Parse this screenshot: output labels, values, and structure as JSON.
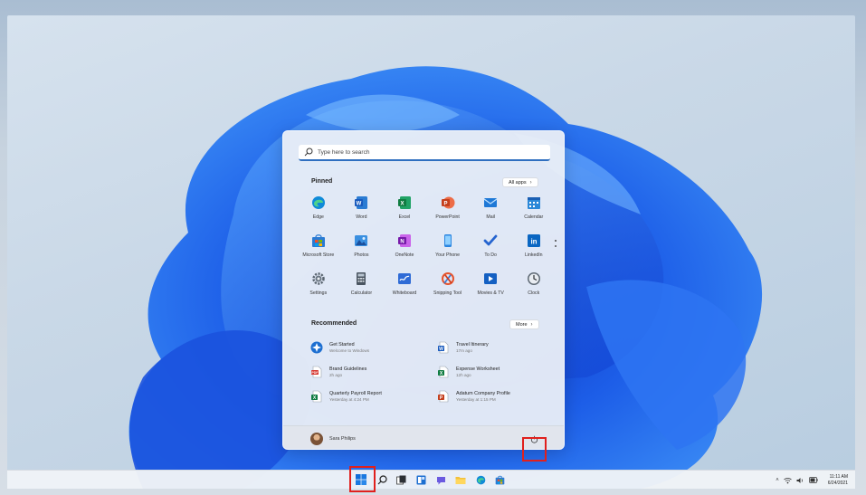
{
  "search": {
    "placeholder": "Type here to search"
  },
  "pinned": {
    "title": "Pinned",
    "all_apps_label": "All apps",
    "apps": [
      {
        "label": "Edge",
        "icon": "edge-icon"
      },
      {
        "label": "Word",
        "icon": "word-icon"
      },
      {
        "label": "Excel",
        "icon": "excel-icon"
      },
      {
        "label": "PowerPoint",
        "icon": "powerpoint-icon"
      },
      {
        "label": "Mail",
        "icon": "mail-icon"
      },
      {
        "label": "Calendar",
        "icon": "calendar-icon"
      },
      {
        "label": "Microsoft Store",
        "icon": "store-icon"
      },
      {
        "label": "Photos",
        "icon": "photos-icon"
      },
      {
        "label": "OneNote",
        "icon": "onenote-icon"
      },
      {
        "label": "Your Phone",
        "icon": "phone-icon"
      },
      {
        "label": "To Do",
        "icon": "todo-icon"
      },
      {
        "label": "LinkedIn",
        "icon": "linkedin-icon"
      },
      {
        "label": "Settings",
        "icon": "settings-icon"
      },
      {
        "label": "Calculator",
        "icon": "calculator-icon"
      },
      {
        "label": "Whiteboard",
        "icon": "whiteboard-icon"
      },
      {
        "label": "Snipping Tool",
        "icon": "snipping-icon"
      },
      {
        "label": "Movies & TV",
        "icon": "movies-icon"
      },
      {
        "label": "Clock",
        "icon": "clock-icon"
      }
    ]
  },
  "recommended": {
    "title": "Recommended",
    "more_label": "More",
    "items": [
      {
        "name": "Get Started",
        "sub": "Welcome to Windows",
        "icon": "get-started-icon"
      },
      {
        "name": "Travel Itinerary",
        "sub": "17m ago",
        "icon": "word-doc-icon"
      },
      {
        "name": "Brand Guidelines",
        "sub": "2h ago",
        "icon": "pdf-icon"
      },
      {
        "name": "Expense Worksheet",
        "sub": "12h ago",
        "icon": "excel-doc-icon"
      },
      {
        "name": "Quarterly Payroll Report",
        "sub": "Yesterday at 4:24 PM",
        "icon": "excel-doc-icon"
      },
      {
        "name": "Adatum Company Profile",
        "sub": "Yesterday at 1:15 PM",
        "icon": "powerpoint-doc-icon"
      }
    ]
  },
  "user": {
    "name": "Sara Philips"
  },
  "taskbar": {
    "icons": [
      "start-icon",
      "search-icon",
      "task-view-icon",
      "widgets-icon",
      "chat-icon",
      "file-explorer-icon",
      "edge-icon",
      "store-icon"
    ]
  },
  "tray": {
    "time": "11:11 AM",
    "date": "6/24/2021"
  },
  "colors": {
    "highlight": "#e0201d",
    "accent": "#2f6fc0"
  }
}
